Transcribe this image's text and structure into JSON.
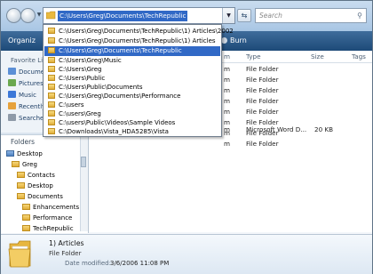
{
  "address_bar": {
    "path": "C:\\Users\\Greg\\Documents\\TechRepublic",
    "search_placeholder": "Search"
  },
  "toolbar": {
    "organize_label": "Organiz",
    "burn_label": "Burn"
  },
  "navigation": {
    "favorites_label": "Favorite Lin",
    "favorites": [
      {
        "label": "Documen",
        "icon": "documents-icon",
        "color": "#5b8fd6"
      },
      {
        "label": "Pictures",
        "icon": "pictures-icon",
        "color": "#6aa84f"
      },
      {
        "label": "Music",
        "icon": "music-icon",
        "color": "#3c78d8"
      },
      {
        "label": "Recently",
        "icon": "recent-icon",
        "color": "#e6a23c"
      },
      {
        "label": "Searche",
        "icon": "searches-icon",
        "color": "#8e9aa8"
      }
    ],
    "folders_label": "Folders",
    "tree": [
      {
        "label": "Desktop"
      },
      {
        "label": "Greg"
      },
      {
        "label": "Contacts"
      },
      {
        "label": "Desktop"
      },
      {
        "label": "Documents"
      },
      {
        "label": "Enhancements"
      },
      {
        "label": "Performance"
      },
      {
        "label": "TechRepublic"
      }
    ]
  },
  "file_list": {
    "columns": [
      "m",
      "Type",
      "Size",
      "Tags"
    ],
    "rows": [
      {
        "name": "m",
        "type": "File Folder",
        "size": ""
      },
      {
        "name": "m",
        "type": "File Folder",
        "size": ""
      },
      {
        "name": "m",
        "type": "File Folder",
        "size": ""
      },
      {
        "name": "m",
        "type": "File Folder",
        "size": ""
      },
      {
        "name": "m",
        "type": "File Folder",
        "size": ""
      },
      {
        "name": "m",
        "type": "File Folder",
        "size": ""
      },
      {
        "name": "m",
        "type": "File Folder",
        "size": ""
      },
      {
        "name": "m",
        "type": "File Folder",
        "size": ""
      },
      {
        "name": "m",
        "type": "Microsoft Word D...",
        "size": "20 KB"
      }
    ]
  },
  "address_dropdown": {
    "items": [
      "C:\\Users\\Greg\\Documents\\TechRepublic\\1) Articles\\2002",
      "C:\\Users\\Greg\\Documents\\TechRepublic\\1) Articles",
      "C:\\Users\\Greg\\Documents\\TechRepublic",
      "C:\\Users\\Greg\\Music",
      "C:\\Users\\Greg",
      "C:\\Users\\Public",
      "C:\\Users\\Public\\Documents",
      "C:\\Users\\Greg\\Documents\\Performance",
      "C:\\users",
      "C:\\users\\Greg",
      "C:\\users\\Public\\Videos\\Sample Videos",
      "C:\\Downloads\\Vista_HDA5285\\Vista"
    ],
    "selected_index": 2
  },
  "details_pane": {
    "name": "1) Articles",
    "type": "File Folder",
    "modified_label": "Date modified:",
    "modified_value": "3/6/2006 11:08 PM"
  }
}
